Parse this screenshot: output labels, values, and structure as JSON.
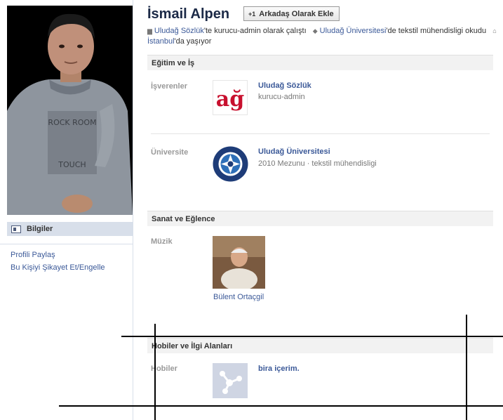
{
  "profile": {
    "name": "İsmail Alpen",
    "add_friend_label": "Arkadaş Olarak Ekle",
    "add_friend_icon": "+1",
    "info_line1": {
      "company": "Uludağ Sözlük",
      "company_suffix": "'te kurucu-admin olarak çalıştı",
      "school": "Uludağ Üniversitesi",
      "school_suffix": "'de tekstil mühendisligi okudu"
    },
    "info_line2": {
      "city": "İstanbul",
      "city_suffix": "'da yaşıyor"
    }
  },
  "left_nav": {
    "info_label": "Bilgiler",
    "links": [
      "Profili Paylaş",
      "Bu Kişiyi Şikayet Et/Engelle"
    ]
  },
  "sections": {
    "education": {
      "title": "Eğitim ve İş",
      "employers_label": "İşverenler",
      "employer": {
        "name": "Uludağ Sözlük",
        "role": "kurucu-admin",
        "logo_text": "ağ"
      },
      "university_label": "Üniversite",
      "university": {
        "name": "Uludağ Üniversitesi",
        "detail": "2010 Mezunu · tekstil mühendisligi"
      }
    },
    "arts": {
      "title": "Sanat ve Eğlence",
      "music_label": "Müzik",
      "artist": "Bülent Ortaçgil"
    },
    "hobbies": {
      "title": "Hobiler ve İlgi Alanları",
      "label": "Hobiler",
      "item": "bira içerim."
    }
  },
  "colors": {
    "link": "#3b5998",
    "section_header_bg": "#f2f2f2",
    "nav_highlight": "#d8dfea"
  }
}
